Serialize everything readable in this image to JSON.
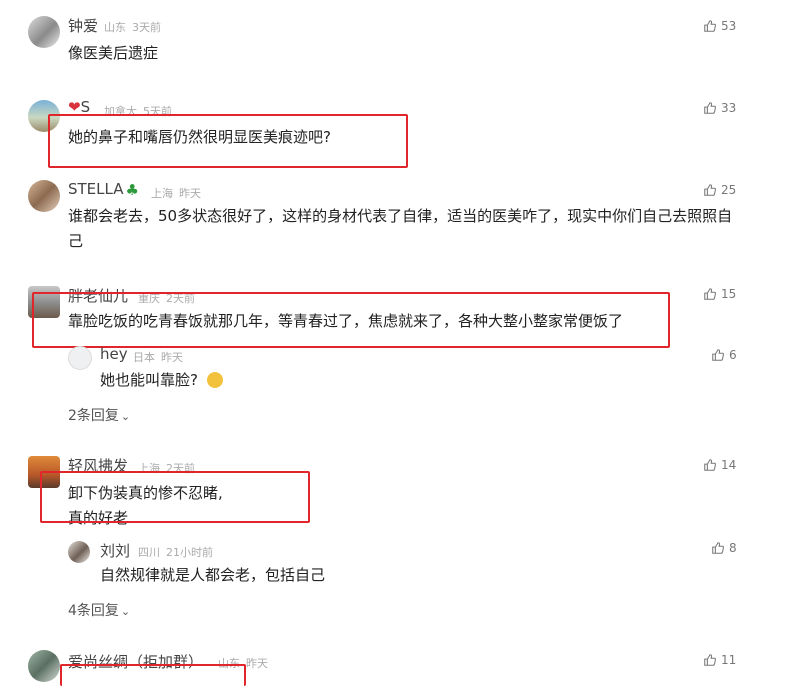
{
  "comments": [
    {
      "name": "钟爱",
      "location": "山东",
      "time": "3天前",
      "text": "像医美后遗症",
      "likes": "53"
    },
    {
      "name": "S",
      "location": "加拿大",
      "time": "5天前",
      "text": "她的鼻子和嘴唇仍然很明显医美痕迹吧?",
      "likes": "33"
    },
    {
      "name": "STELLA",
      "location": "上海",
      "time": "昨天",
      "text": "谁都会老去，50多状态很好了，这样的身材代表了自律，适当的医美咋了，现实中你们自己去照照自己",
      "likes": "25"
    },
    {
      "name": "胖老仙儿",
      "location": "重庆",
      "time": "2天前",
      "text": "靠脸吃饭的吃青春饭就那几年，等青春过了，焦虑就来了，各种大整小整家常便饭了",
      "likes": "15",
      "reply": {
        "name": "hey",
        "location": "日本",
        "time": "昨天",
        "text": "她也能叫靠脸?",
        "likes": "6"
      },
      "more": "2条回复"
    },
    {
      "name": "轻风拂发",
      "location": "上海",
      "time": "2天前",
      "text_line1": "卸下伪装真的惨不忍睹,",
      "text_line2": "真的好老",
      "likes": "14",
      "reply": {
        "name": "刘刘",
        "location": "四川",
        "time": "21小时前",
        "text": "自然规律就是人都会老，包括自己",
        "likes": "8"
      },
      "more": "4条回复"
    },
    {
      "name": "爱尚丝绸（拒加群）",
      "location": "山东",
      "time": "昨天",
      "likes": "11"
    }
  ],
  "colors": {
    "highlight": "#e0262a",
    "heart": "#d9343d",
    "clover": "#2e9a3e"
  },
  "icons": {
    "like": "thumbs-up-icon",
    "more": "chevron-down-icon"
  }
}
